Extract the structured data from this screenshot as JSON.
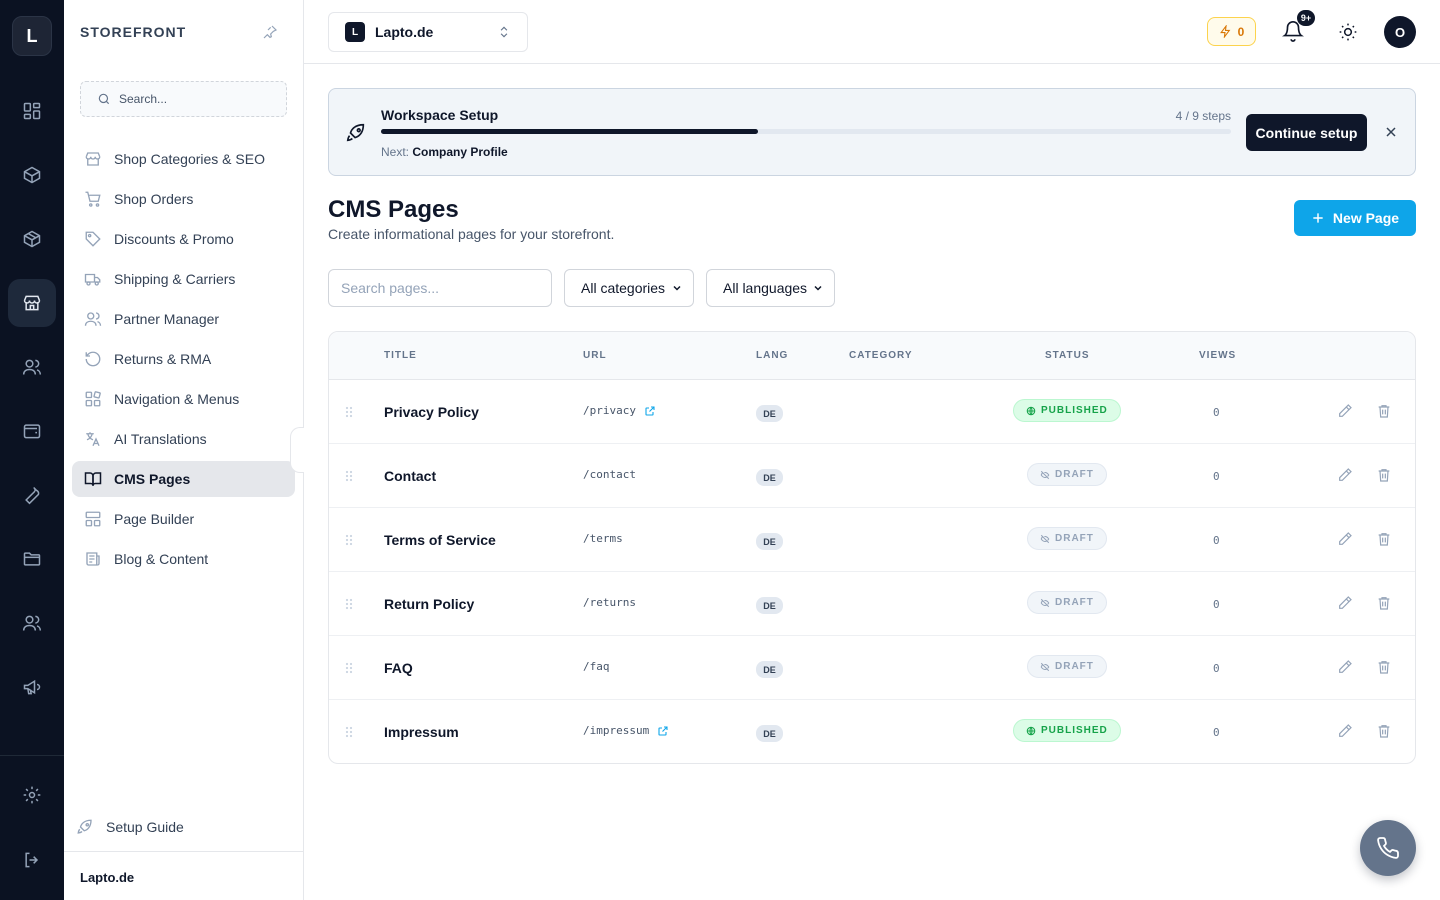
{
  "rail": {
    "logo": "L",
    "items": [
      {
        "icon": "dashboard-icon"
      },
      {
        "icon": "package-icon"
      },
      {
        "icon": "box-icon"
      },
      {
        "icon": "storefront-icon",
        "active": true
      },
      {
        "icon": "users-icon"
      },
      {
        "icon": "wallet-icon"
      },
      {
        "icon": "wrench-icon"
      },
      {
        "icon": "folder-icon"
      },
      {
        "icon": "team-icon"
      },
      {
        "icon": "megaphone-icon"
      },
      {
        "icon": "settings-icon"
      },
      {
        "icon": "logout-icon"
      }
    ]
  },
  "sidebar": {
    "title": "STOREFRONT",
    "search_placeholder": "Search...",
    "items": [
      {
        "label": "Shop Categories & SEO",
        "icon": "store-icon"
      },
      {
        "label": "Shop Orders",
        "icon": "cart-icon"
      },
      {
        "label": "Discounts & Promo",
        "icon": "tag-icon"
      },
      {
        "label": "Shipping & Carriers",
        "icon": "truck-icon"
      },
      {
        "label": "Partner Manager",
        "icon": "users-icon"
      },
      {
        "label": "Returns & RMA",
        "icon": "return-icon"
      },
      {
        "label": "Navigation & Menus",
        "icon": "menu-blocks-icon"
      },
      {
        "label": "AI Translations",
        "icon": "translate-icon"
      },
      {
        "label": "CMS Pages",
        "icon": "book-icon",
        "active": true
      },
      {
        "label": "Page Builder",
        "icon": "layout-icon"
      },
      {
        "label": "Blog & Content",
        "icon": "newspaper-icon"
      }
    ],
    "setup_guide": "Setup Guide",
    "footer": "Lapto.de"
  },
  "topbar": {
    "workspace_badge": "L",
    "workspace_name": "Lapto.de",
    "credits": "0",
    "notifications": "9+",
    "avatar": "O"
  },
  "banner": {
    "title": "Workspace Setup",
    "steps": "4 / 9 steps",
    "progress": 0.444,
    "next_label": "Next:",
    "next_value": "Company Profile",
    "cta": "Continue setup"
  },
  "page": {
    "title": "CMS Pages",
    "subtitle": "Create informational pages for your storefront.",
    "new_button": "New Page"
  },
  "filters": {
    "search_placeholder": "Search pages...",
    "category": "All categories",
    "language": "All languages"
  },
  "table": {
    "headers": {
      "title": "TITLE",
      "url": "URL",
      "lang": "LANG",
      "category": "CATEGORY",
      "status": "STATUS",
      "views": "VIEWS"
    },
    "rows": [
      {
        "title": "Privacy Policy",
        "url": "/privacy",
        "external": true,
        "lang": "DE",
        "category": "",
        "status": "PUBLISHED",
        "published": true,
        "views": "0"
      },
      {
        "title": "Contact",
        "url": "/contact",
        "external": false,
        "lang": "DE",
        "category": "",
        "status": "DRAFT",
        "published": false,
        "views": "0"
      },
      {
        "title": "Terms of Service",
        "url": "/terms",
        "external": false,
        "lang": "DE",
        "category": "",
        "status": "DRAFT",
        "published": false,
        "views": "0"
      },
      {
        "title": "Return Policy",
        "url": "/returns",
        "external": false,
        "lang": "DE",
        "category": "",
        "status": "DRAFT",
        "published": false,
        "views": "0"
      },
      {
        "title": "FAQ",
        "url": "/faq",
        "external": false,
        "lang": "DE",
        "category": "",
        "status": "DRAFT",
        "published": false,
        "views": "0"
      },
      {
        "title": "Impressum",
        "url": "/impressum",
        "external": true,
        "lang": "DE",
        "category": "",
        "status": "PUBLISHED",
        "published": true,
        "views": "0"
      }
    ]
  },
  "colors": {
    "rail_bg": "#0b1222",
    "accent": "#0ea5e9",
    "primary": "#0f172a",
    "published": "#16a34a"
  }
}
